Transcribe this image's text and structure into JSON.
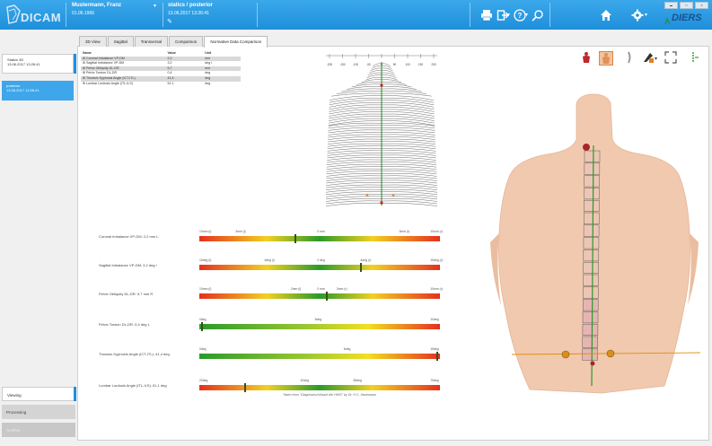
{
  "header": {
    "app_name": "DICAM",
    "patient_name": "Mustermann, Franz",
    "patient_dob": "01.06.1966",
    "measurement": "statics / posterior",
    "measurement_time": "13.06.2017 13:26:41",
    "brand": "DIERS"
  },
  "sessions": [
    {
      "title": "Statics 3D",
      "time": "13.06.2017 13:26:41"
    },
    {
      "title": "posterior",
      "time": "13.06.2017 13:26:41"
    }
  ],
  "left_buttons": [
    "Viewing",
    "Processing",
    "Archive"
  ],
  "tabs": [
    "3D View",
    "Sagittal",
    "Transversal",
    "Comparison",
    "Normative Data Comparison"
  ],
  "active_tab": "Normative Data Comparison",
  "table": {
    "headers": [
      "Name",
      "Value",
      "Unit"
    ],
    "rows": [
      {
        "name": "Coronal Imbalance VP-DM",
        "value": "2,2",
        "unit": "mm"
      },
      {
        "name": "Sagittal Imbalance VP-DM",
        "value": "3,2",
        "unit": "deg l"
      },
      {
        "name": "Pelvic Obliquity DL-DR",
        "value": "5,7",
        "unit": "mm"
      },
      {
        "name": "Pelvic Torsion DL-DR",
        "value": "0,4",
        "unit": "deg"
      },
      {
        "name": "Thoracic Kyphosis Angle (ICT-ITL)",
        "value": "41,4",
        "unit": "deg"
      },
      {
        "name": "Lumbar Lordosis Angle (ITL-ILS)",
        "value": "51,1",
        "unit": "deg"
      }
    ]
  },
  "bars": [
    {
      "label": "Coronal Imbalance VP-DM: 2,2 mm L",
      "type": "rgyr",
      "fraction": 0.4,
      "ticks": [
        {
          "t": "10mm (l)",
          "p": 0.0
        },
        {
          "t": "3mm (l)",
          "p": 0.15
        },
        {
          "t": "0 mm",
          "p": 0.49
        },
        {
          "t": "3mm (r)",
          "p": 0.83
        },
        {
          "t": "10mm (r)",
          "p": 0.96
        }
      ]
    },
    {
      "label": "Sagittal Imbalance VP-DM: 3,2 deg l",
      "type": "rgyr",
      "fraction": 0.67,
      "ticks": [
        {
          "t": "15deg (l)",
          "p": 0.0
        },
        {
          "t": "4deg (l)",
          "p": 0.27
        },
        {
          "t": "0 deg",
          "p": 0.49
        },
        {
          "t": "4deg (r)",
          "p": 0.67
        },
        {
          "t": "15deg (r)",
          "p": 0.96
        }
      ]
    },
    {
      "label": "Pelvic Obliquity DL-DR: 5,7 mm R",
      "type": "rgyr",
      "fraction": 0.53,
      "ticks": [
        {
          "t": "10mm (l)",
          "p": 0.0
        },
        {
          "t": "2mm (l)",
          "p": 0.38
        },
        {
          "t": "0 mm",
          "p": 0.49
        },
        {
          "t": "2mm (r)",
          "p": 0.57
        },
        {
          "t": "10mm (r)",
          "p": 0.96
        }
      ]
    },
    {
      "label": "Pelvic Torsion DL-DR: 0,4 deg L",
      "type": "gyr",
      "fraction": 0.01,
      "ticks": [
        {
          "t": "0deg",
          "p": 0.0
        },
        {
          "t": "5deg",
          "p": 0.48
        },
        {
          "t": "10deg",
          "p": 0.96
        }
      ]
    },
    {
      "label": "Thoracic Kyphosis Angle (ICT-ITL): 41,4 deg",
      "type": "gyr",
      "fraction": 0.99,
      "ticks": [
        {
          "t": "0deg",
          "p": 0.0
        },
        {
          "t": "6deg",
          "p": 0.6
        },
        {
          "t": "15deg",
          "p": 0.96
        }
      ]
    },
    {
      "label": "Lumbar Lordosis Angle (ITL-ILS): 51,1 deg",
      "type": "rgyr",
      "fraction": 0.19,
      "ticks": [
        {
          "t": "20deg",
          "p": 0.0
        },
        {
          "t": "42deg",
          "p": 0.42
        },
        {
          "t": "55deg",
          "p": 0.64
        },
        {
          "t": "75deg",
          "p": 0.96
        }
      ]
    }
  ],
  "credit": "Taken from \"Diagnoseschlüssel der HWS\" by Dr. H.C. Hasemann",
  "ruler_labels": [
    "-200",
    "-150",
    "-100",
    "-50",
    "0",
    "50",
    "100",
    "150",
    "200"
  ],
  "colors": {
    "accent": "#1f8fdb",
    "skin": "#f1c9ae",
    "spine": "#2a9a2a"
  }
}
